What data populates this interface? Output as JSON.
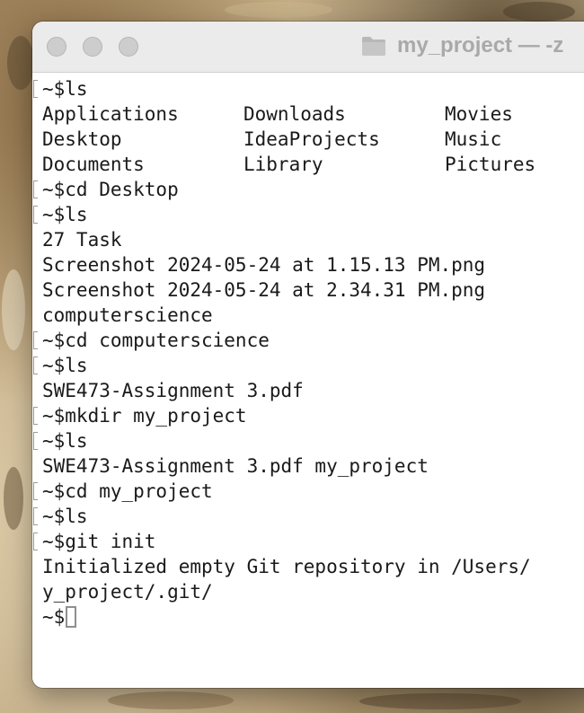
{
  "window": {
    "title": "my_project — -z"
  },
  "terminal": {
    "lines": [
      {
        "type": "prompt",
        "text": "~$ls"
      },
      {
        "type": "grid",
        "cols": [
          "Applications",
          "Downloads",
          "Movies"
        ]
      },
      {
        "type": "grid",
        "cols": [
          "Desktop",
          "IdeaProjects",
          "Music"
        ]
      },
      {
        "type": "grid",
        "cols": [
          "Documents",
          "Library",
          "Pictures"
        ]
      },
      {
        "type": "prompt",
        "text": "~$cd Desktop"
      },
      {
        "type": "prompt",
        "text": "~$ls"
      },
      {
        "type": "output",
        "text": "27 Task"
      },
      {
        "type": "output",
        "text": "Screenshot 2024-05-24 at 1.15.13 PM.png"
      },
      {
        "type": "output",
        "text": "Screenshot 2024-05-24 at 2.34.31 PM.png"
      },
      {
        "type": "output",
        "text": "computerscience"
      },
      {
        "type": "prompt",
        "text": "~$cd computerscience"
      },
      {
        "type": "prompt",
        "text": "~$ls"
      },
      {
        "type": "output",
        "text": "SWE473-Assignment 3.pdf"
      },
      {
        "type": "prompt",
        "text": "~$mkdir my_project"
      },
      {
        "type": "prompt",
        "text": "~$ls"
      },
      {
        "type": "output",
        "text": "SWE473-Assignment 3.pdf my_project"
      },
      {
        "type": "prompt",
        "text": "~$cd my_project"
      },
      {
        "type": "prompt",
        "text": "~$ls"
      },
      {
        "type": "prompt",
        "text": "~$git init"
      },
      {
        "type": "output",
        "text": "Initialized empty Git repository in /Users/"
      },
      {
        "type": "output",
        "text": "y_project/.git/"
      },
      {
        "type": "current",
        "text": "~$"
      }
    ]
  },
  "icons": {
    "titlebar": "folder-icon",
    "cursor": "block-cursor"
  },
  "colors": {
    "titlebar_bg": "#ebebeb",
    "title_text": "#a9a9a9",
    "traffic_light_inactive": "#cdcdcd",
    "terminal_bg": "#ffffff",
    "terminal_text": "#1a1a1a"
  }
}
